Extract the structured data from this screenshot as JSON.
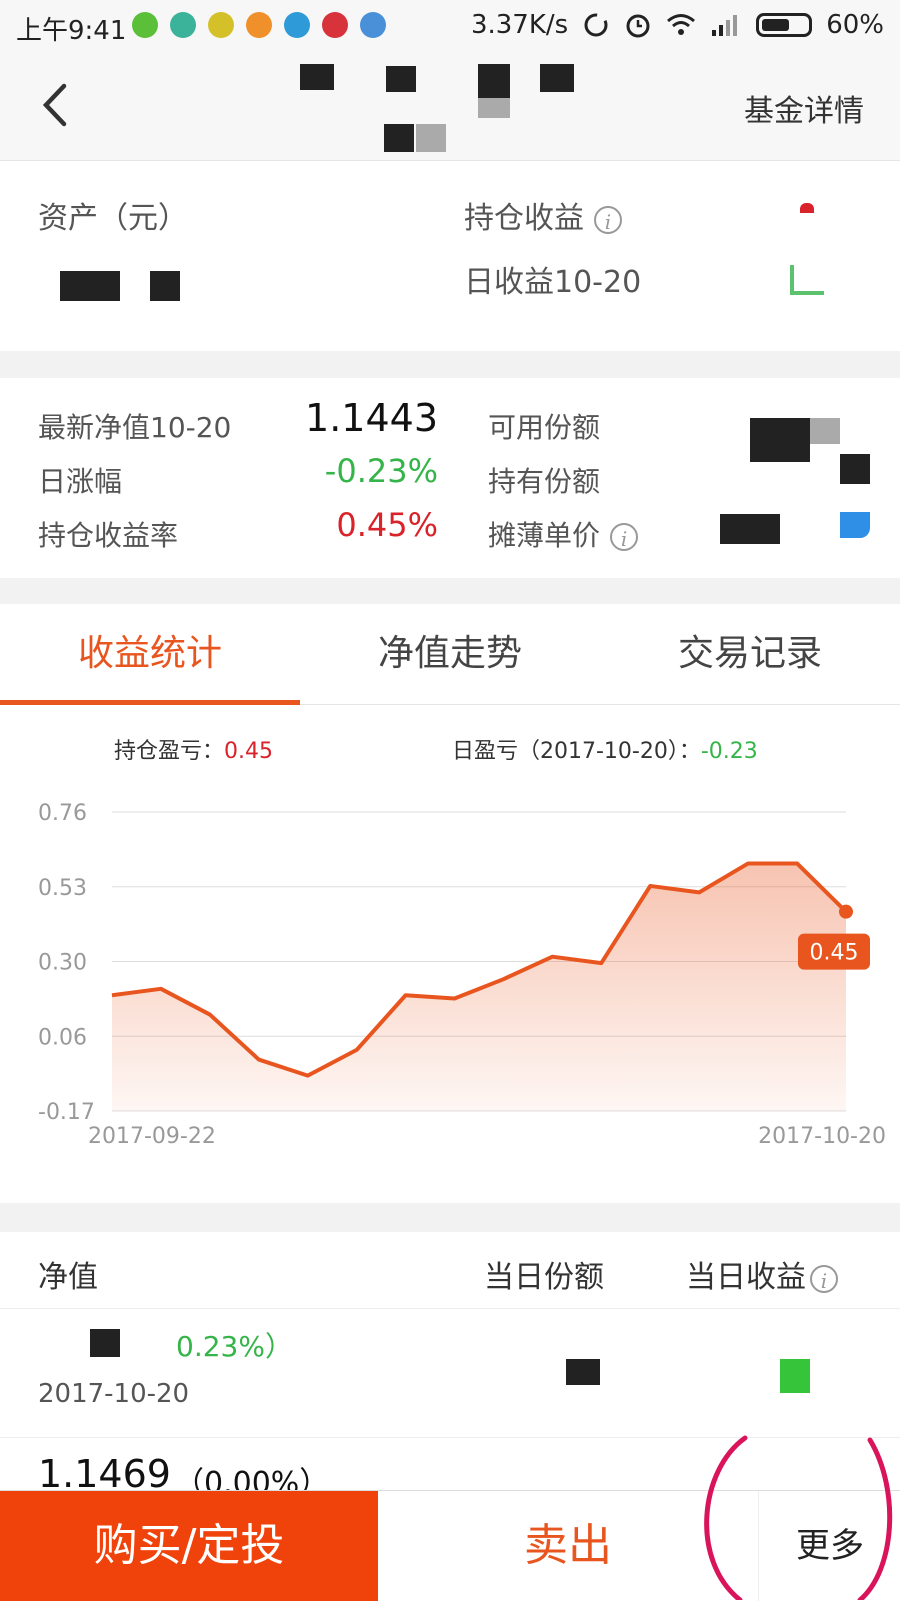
{
  "status_bar": {
    "time": "上午9:41",
    "net_speed": "3.37K/s",
    "battery": "60%",
    "battery_level": 0.6
  },
  "nav": {
    "right_label": "基金详情"
  },
  "assets": {
    "asset_label": "资产（元）",
    "holding_profit_label": "持仓收益",
    "daily_profit_label": "日收益10-20"
  },
  "fund_stats": {
    "nav_label": "最新净值10-20",
    "nav_value": "1.1443",
    "daily_change_label": "日涨幅",
    "daily_change_value": "-0.23%",
    "holding_rate_label": "持仓收益率",
    "holding_rate_value": "0.45%",
    "available_shares_label": "可用份额",
    "held_shares_label": "持有份额",
    "avg_cost_label": "摊薄单价"
  },
  "tabs": [
    {
      "label": "收益统计"
    },
    {
      "label": "净值走势"
    },
    {
      "label": "交易记录"
    }
  ],
  "chart_legend": {
    "holding_label": "持仓盈亏：",
    "holding_value": "0.45",
    "daily_label": "日盈亏（2017-10-20）：",
    "daily_value": "-0.23"
  },
  "chart_data": {
    "type": "area",
    "x_start_label": "2017-09-22",
    "x_end_label": "2017-10-20",
    "y_ticks": [
      "0.76",
      "0.53",
      "0.30",
      "0.06",
      "-0.17"
    ],
    "ylim": [
      -0.17,
      0.76
    ],
    "values": [
      0.19,
      0.21,
      0.13,
      -0.01,
      -0.06,
      0.02,
      0.19,
      0.18,
      0.24,
      0.31,
      0.29,
      0.53,
      0.51,
      0.6,
      0.6,
      0.45
    ],
    "last_label": "0.45",
    "grid": true,
    "line_color": "#e8551f"
  },
  "table": {
    "col_nav": "净值",
    "col_shares": "当日份额",
    "col_profit": "当日收益",
    "rows": [
      {
        "change": "0.23%）",
        "date": "2017-10-20"
      },
      {
        "nav": "1.1469",
        "change": "（0.00%）"
      }
    ]
  },
  "actions": {
    "buy": "购买/定投",
    "sell": "卖出",
    "more": "更多"
  }
}
